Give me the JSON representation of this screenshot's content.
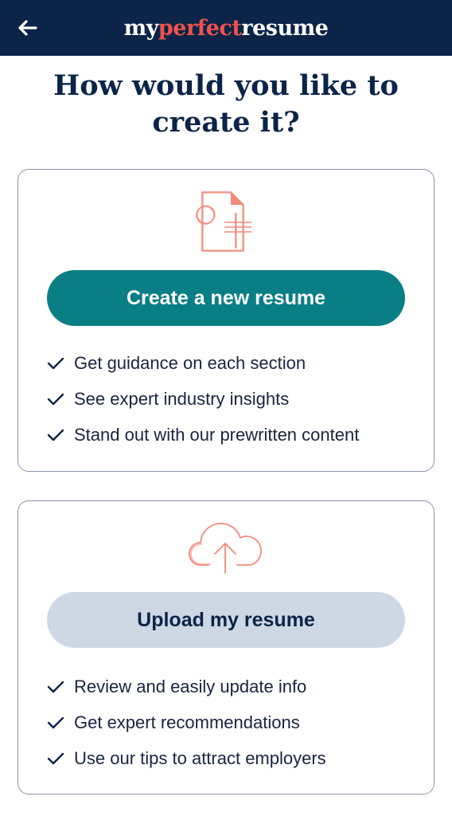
{
  "header": {
    "logo_part1": "my",
    "logo_part2": "perfect",
    "logo_part3": "resume",
    "back_icon": "arrow-left-icon"
  },
  "page": {
    "title_line1": "How would you like to",
    "title_line2": "create it?"
  },
  "create_card": {
    "icon": "document-icon",
    "button_label": "Create a new resume",
    "features": [
      "Get guidance on each section",
      "See expert industry insights",
      "Stand out with our prewritten content"
    ]
  },
  "upload_card": {
    "icon": "cloud-upload-icon",
    "button_label": "Upload my resume",
    "features": [
      "Review and easily update info",
      "Get expert recommendations",
      "Use our tips to attract employers"
    ]
  },
  "colors": {
    "header_bg": "#0b2447",
    "brand_accent": "#f0524c",
    "primary_button": "#0a7e85",
    "secondary_button": "#cdd8e4",
    "illustration": "#f28a78"
  }
}
